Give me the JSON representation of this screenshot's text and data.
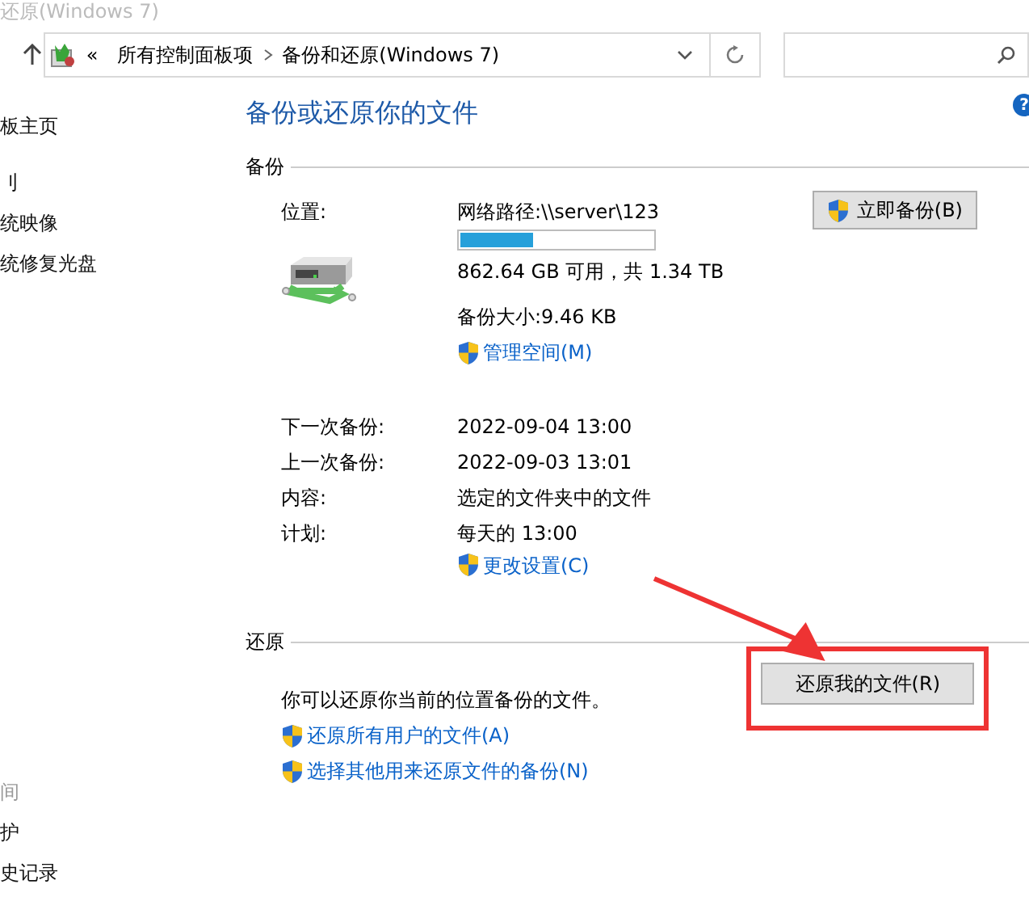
{
  "window": {
    "title": "还原(Windows 7)"
  },
  "address_bar": {
    "back_path": "«",
    "crumbs": [
      "所有控制面板项",
      "备份和还原(Windows 7)"
    ]
  },
  "help": {
    "label": "?"
  },
  "sidebar": {
    "top_items": [
      {
        "label": "板主页",
        "disabled": false
      },
      {
        "label": "刂",
        "disabled": false
      },
      {
        "label": "统映像",
        "disabled": false
      },
      {
        "label": "统修复光盘",
        "disabled": false
      }
    ],
    "bottom_items": [
      {
        "label": "间",
        "disabled": true
      },
      {
        "label": "护",
        "disabled": false
      },
      {
        "label": "史记录",
        "disabled": false
      }
    ]
  },
  "main": {
    "title": "备份或还原你的文件",
    "backup": {
      "heading": "备份",
      "location_label": "位置:",
      "location": "网络路径:\\\\server\\123",
      "level": 0.38,
      "free_space": "862.64 GB 可用，共 1.34 TB",
      "size": "备份大小:9.46 KB",
      "manage_link": "管理空间(M)",
      "backup_button": "立即备份(B)",
      "details": [
        {
          "label": "下一次备份:",
          "value": "2022-09-04 13:00"
        },
        {
          "label": "上一次备份:",
          "value": "2022-09-03 13:01"
        },
        {
          "label": "内容:",
          "value": "选定的文件夹中的文件"
        },
        {
          "label": "计划:",
          "value": "每天的 13:00"
        }
      ],
      "settings_link": "更改设置(C)"
    },
    "restore": {
      "heading": "还原",
      "text": "你可以还原你当前的位置备份的文件。",
      "links": [
        "还原所有用户的文件(A)",
        "选择其他用来还原文件的备份(N)"
      ],
      "restore_button": "还原我的文件(R)",
      "highlighted": true
    }
  },
  "annotation": {
    "color": "#ee3333"
  }
}
